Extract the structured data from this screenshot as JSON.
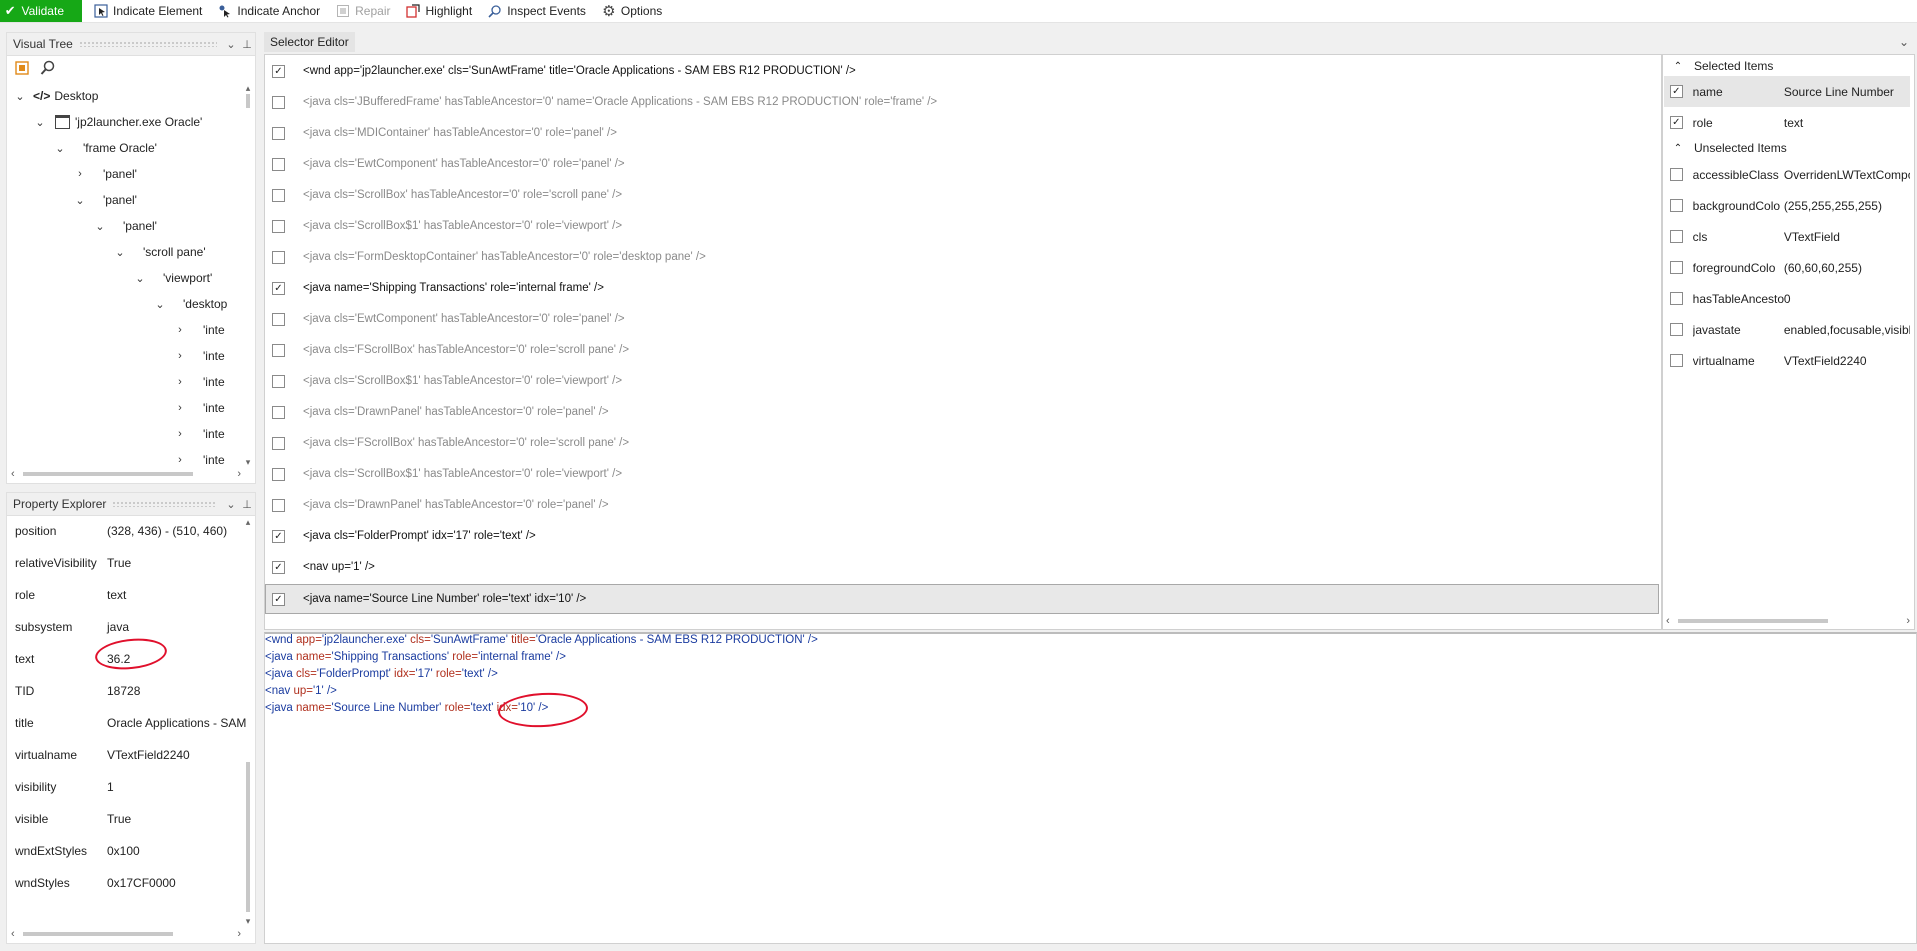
{
  "toolbar": {
    "validate": "Validate",
    "indicate_element": "Indicate Element",
    "indicate_anchor": "Indicate Anchor",
    "repair": "Repair",
    "highlight": "Highlight",
    "inspect_events": "Inspect Events",
    "options": "Options"
  },
  "visual_tree": {
    "title": "Visual Tree",
    "nodes": [
      "Desktop",
      "'jp2launcher.exe Oracle'",
      "'frame Oracle'",
      "'panel'",
      "'panel'",
      "'panel'",
      "'scroll pane'",
      "'viewport'",
      "'desktop",
      "'inte",
      "'inte",
      "'inte",
      "'inte",
      "'inte",
      "'inte"
    ]
  },
  "property_explorer": {
    "title": "Property Explorer",
    "rows": [
      {
        "name": "position",
        "value": "(328, 436) - (510, 460)"
      },
      {
        "name": "relativeVisibility",
        "value": "True"
      },
      {
        "name": "role",
        "value": "text"
      },
      {
        "name": "subsystem",
        "value": "java"
      },
      {
        "name": "text",
        "value": "36.2"
      },
      {
        "name": "TID",
        "value": "18728"
      },
      {
        "name": "title",
        "value": "Oracle Applications - SAM"
      },
      {
        "name": "virtualname",
        "value": "VTextField2240"
      },
      {
        "name": "visibility",
        "value": "1"
      },
      {
        "name": "visible",
        "value": "True"
      },
      {
        "name": "wndExtStyles",
        "value": "0x100"
      },
      {
        "name": "wndStyles",
        "value": "0x17CF0000"
      }
    ]
  },
  "selector_editor": {
    "title": "Selector Editor",
    "rows": [
      {
        "text": "<wnd app='jp2launcher.exe' cls='SunAwtFrame' title='Oracle Applications - SAM EBS R12 PRODUCTION' />",
        "checked": true
      },
      {
        "text": "<java cls='JBufferedFrame' hasTableAncestor='0' name='Oracle Applications - SAM EBS R12 PRODUCTION' role='frame' />",
        "checked": false
      },
      {
        "text": "<java cls='MDIContainer' hasTableAncestor='0' role='panel' />",
        "checked": false
      },
      {
        "text": "<java cls='EwtComponent' hasTableAncestor='0' role='panel' />",
        "checked": false
      },
      {
        "text": "<java cls='ScrollBox' hasTableAncestor='0' role='scroll pane' />",
        "checked": false
      },
      {
        "text": "<java cls='ScrollBox$1' hasTableAncestor='0' role='viewport' />",
        "checked": false
      },
      {
        "text": "<java cls='FormDesktopContainer' hasTableAncestor='0' role='desktop pane' />",
        "checked": false
      },
      {
        "text": "<java name='Shipping Transactions' role='internal frame' />",
        "checked": true
      },
      {
        "text": "<java cls='EwtComponent' hasTableAncestor='0' role='panel' />",
        "checked": false
      },
      {
        "text": "<java cls='FScrollBox' hasTableAncestor='0' role='scroll pane' />",
        "checked": false
      },
      {
        "text": "<java cls='ScrollBox$1' hasTableAncestor='0' role='viewport' />",
        "checked": false
      },
      {
        "text": "<java cls='DrawnPanel' hasTableAncestor='0' role='panel' />",
        "checked": false
      },
      {
        "text": "<java cls='FScrollBox' hasTableAncestor='0' role='scroll pane' />",
        "checked": false
      },
      {
        "text": "<java cls='ScrollBox$1' hasTableAncestor='0' role='viewport' />",
        "checked": false
      },
      {
        "text": "<java cls='DrawnPanel' hasTableAncestor='0' role='panel' />",
        "checked": false
      },
      {
        "text": "<java cls='FolderPrompt' idx='17' role='text' />",
        "checked": true
      },
      {
        "text": "<nav up='1' />",
        "checked": true
      },
      {
        "text": "<java name='Source Line Number' role='text' idx='10' />",
        "checked": true
      }
    ],
    "code": {
      "line1": {
        "t1": "<wnd ",
        "a1": "app=",
        "v1": "'jp2launcher.exe' ",
        "a2": "cls=",
        "v2": "'SunAwtFrame' ",
        "a3": "title=",
        "v3": "'Oracle Applications - SAM EBS R12 PRODUCTION' />"
      },
      "line2": {
        "t1": "<java ",
        "a1": "name=",
        "v1": "'Shipping Transactions' ",
        "a2": "role=",
        "v2": "'internal frame' />"
      },
      "line3": {
        "t1": "<java ",
        "a1": "cls=",
        "v1": "'FolderPrompt' ",
        "a2": "idx=",
        "v2": "'17' ",
        "a3": "role=",
        "v3": "'text' />"
      },
      "line4": {
        "t1": "<nav ",
        "a1": "up=",
        "v1": "'1' />"
      },
      "line5": {
        "t1": "<java ",
        "a1": "name=",
        "v1": "'Source Line Number' ",
        "a2": "role=",
        "v2": "'text' ",
        "a3": "idx=",
        "v3": "'10' />"
      }
    }
  },
  "attributes_panel": {
    "selected_title": "Selected Items",
    "unselected_title": "Unselected Items",
    "selected": [
      {
        "name": "name",
        "value": "Source Line Number"
      },
      {
        "name": "role",
        "value": "text"
      }
    ],
    "unselected": [
      {
        "name": "accessibleClass",
        "value": "OverridenLWTextCompo"
      },
      {
        "name": "backgroundColo",
        "value": "(255,255,255,255)"
      },
      {
        "name": "cls",
        "value": "VTextField"
      },
      {
        "name": "foregroundColo",
        "value": "(60,60,60,255)"
      },
      {
        "name": "hasTableAncesto",
        "value": "0"
      },
      {
        "name": "javastate",
        "value": "enabled,focusable,visibl"
      },
      {
        "name": "virtualname",
        "value": "VTextField2240"
      }
    ]
  },
  "colors": {
    "validate_bg": "#16a816",
    "annotation_red": "#e0102c",
    "code_blue": "#1a3b9f",
    "code_red": "#b0301e"
  }
}
